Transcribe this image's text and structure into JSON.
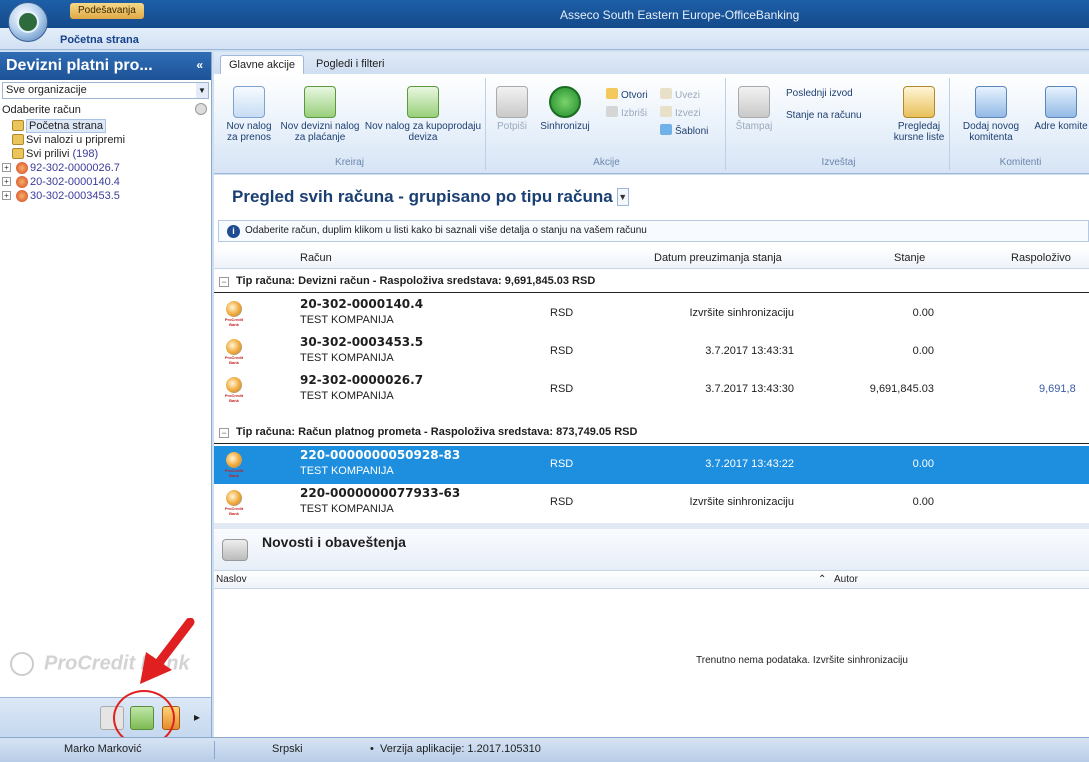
{
  "window": {
    "title": "Asseco South Eastern Europe-OfficeBanking",
    "qat_tab": "Podešavanja",
    "home": "Početna strana"
  },
  "left": {
    "title": "Devizni platni pro...",
    "collapse_glyph": "«",
    "org_select": "Sve organizacije",
    "account_label": "Odaberite račun",
    "tree": [
      {
        "label": "Početna strana"
      },
      {
        "label": "Svi nalozi u pripremi"
      },
      {
        "label": "Svi prilivi",
        "count": "(198)"
      }
    ],
    "accounts": [
      "92-302-0000026.7",
      "20-302-0000140.4",
      "30-302-0003453.5"
    ],
    "watermark": "ProCredit Bank"
  },
  "ribbon": {
    "tabs": [
      "Glavne akcije",
      "Pogledi i filteri"
    ],
    "groups": {
      "kreiraj": "Kreiraj",
      "akcije": "Akcije",
      "izvestaj": "Izveštaj",
      "komitenti": "Komitenti"
    },
    "buttons": {
      "nov_nalog": "Nov nalog za prenos",
      "nov_devizni": "Nov devizni nalog za plaćanje",
      "kupoprodaja": "Nov nalog za kupoprodaju deviza",
      "potpisi": "Potpiši",
      "sinhronizuj": "Sinhronizuj",
      "otvori": "Otvori",
      "izbrisi": "Izbriši",
      "uvezi": "Uvezi",
      "izvezi": "Izvezi",
      "sabloni": "Šabloni",
      "stampaj": "Štampaj",
      "poslednji_izvod": "Poslednji izvod",
      "stanje_racunu": "Stanje na računu",
      "kursne_liste": "Pregledaj kursne liste",
      "dodaj_komitenta": "Dodaj novog komitenta",
      "adresar": "Adre komite"
    }
  },
  "main": {
    "title": "Pregled svih računa - grupisano po tipu računa",
    "info": "Odaberite račun, duplim klikom u listi kako bi saznali više detalja o stanju na vašem računu",
    "columns": {
      "racun": "Račun",
      "datum": "Datum preuzimanja stanja",
      "stanje": "Stanje",
      "raspolozivo": "Raspoloživo"
    },
    "groups": [
      {
        "label": "Tip računa:  Devizni račun  -  Raspoloživa sredstava: 9,691,845.03 RSD"
      },
      {
        "label": "Tip računa:  Račun platnog prometa  -  Raspoloživa sredstava: 873,749.05 RSD"
      }
    ],
    "rows": [
      {
        "num": "20-302-0000140.4",
        "company": "TEST KOMPANIJA",
        "cur": "RSD",
        "date": "Izvršite sinhronizaciju",
        "bal": "0.00",
        "avail": ""
      },
      {
        "num": "30-302-0003453.5",
        "company": "TEST KOMPANIJA",
        "cur": "RSD",
        "date": "3.7.2017 13:43:31",
        "bal": "0.00",
        "avail": ""
      },
      {
        "num": "92-302-0000026.7",
        "company": "TEST KOMPANIJA",
        "cur": "RSD",
        "date": "3.7.2017 13:43:30",
        "bal": "9,691,845.03",
        "avail": "9,691,8"
      },
      {
        "num": "220-0000000050928-83",
        "company": "TEST KOMPANIJA",
        "cur": "RSD",
        "date": "3.7.2017 13:43:22",
        "bal": "0.00",
        "avail": ""
      },
      {
        "num": "220-0000000077933-63",
        "company": "TEST KOMPANIJA",
        "cur": "RSD",
        "date": "Izvršite sinhronizaciju",
        "bal": "0.00",
        "avail": ""
      }
    ],
    "news": {
      "title": "Novosti i obaveštenja",
      "col_naslov": "Naslov",
      "col_autor": "Autor",
      "empty": "Trenutno nema podataka. Izvršite sinhronizaciju"
    }
  },
  "status": {
    "user": "Marko Marković",
    "language": "Srpski",
    "version": "Verzija aplikacije: 1.2017.105310"
  },
  "colors": {
    "selection": "#1e8ede",
    "header": "#1e5296",
    "annotation": "#e02020"
  }
}
